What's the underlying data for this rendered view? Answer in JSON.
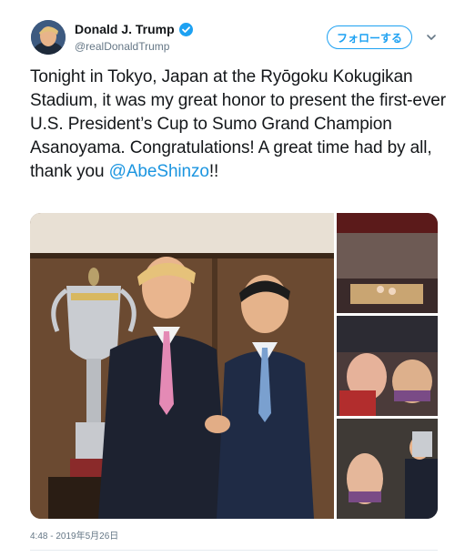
{
  "tweet": {
    "author_name": "Donald J. Trump",
    "author_handle": "@realDonaldTrump",
    "follow_label": "フォローする",
    "text_before_mention": "Tonight in Tokyo, Japan at the Ryōgoku Kokugikan Stadium, it was my great honor to present the first-ever U.S. President’s Cup to Sumo Grand Champion Asanoyama. Congratulations! A great time had by all, thank you ",
    "mention": "@AbeShinzo",
    "text_after_mention": "!!",
    "timestamp": "4:48 - 2019年5月26日"
  },
  "colors": {
    "accent": "#1da1f2",
    "mention": "#1b95e0",
    "muted": "#657786",
    "text": "#14171a"
  },
  "icons": [
    "verified-badge-icon",
    "chevron-down-icon"
  ]
}
